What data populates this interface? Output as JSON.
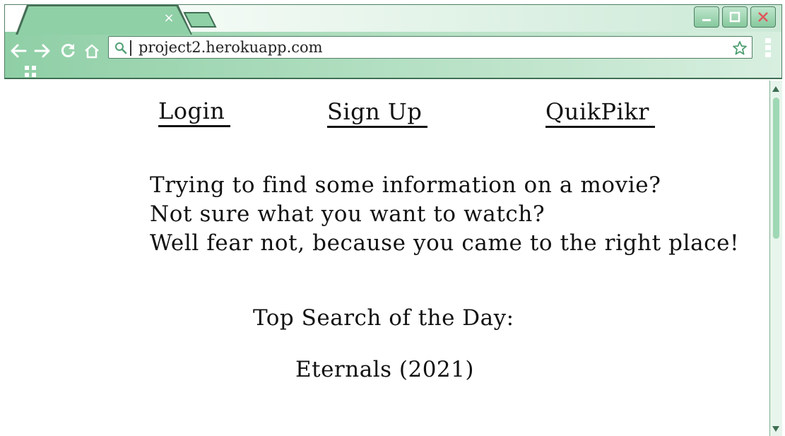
{
  "browser": {
    "url": "project2.herokuapp.com",
    "tab_close_glyph": "×",
    "icons": [
      "back-icon",
      "forward-icon",
      "reload-icon",
      "home-icon",
      "search-icon",
      "star-icon",
      "menu-icon",
      "apps-icon",
      "minimize-icon",
      "maximize-icon",
      "close-icon"
    ],
    "colors": {
      "accent": "#8fd0a6",
      "border": "#4f7f63",
      "close": "#e0565b"
    }
  },
  "nav": {
    "login": "Login",
    "signup": "Sign Up",
    "brand": "QuikPikr"
  },
  "intro": {
    "line1": "Trying to find some information on a movie?",
    "line2": "Not sure what you want to watch?",
    "line3": "Well fear not, because you came to the right place!"
  },
  "top_search": {
    "label": "Top Search of the Day:",
    "value": "Eternals (2021)"
  }
}
